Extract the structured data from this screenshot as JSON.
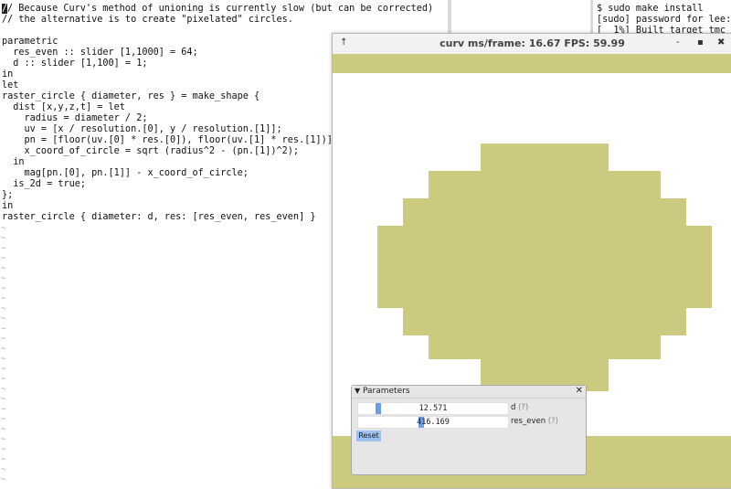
{
  "editor": {
    "lines": [
      "// Because Curv's method of unioning is currently slow (but can be corrected)",
      "// the alternative is to create \"pixelated\" circles.",
      "",
      "parametric",
      "  res_even :: slider [1,1000] = 64;",
      "  d :: slider [1,100] = 1;",
      "in",
      "let",
      "raster_circle { diameter, res } = make_shape {",
      "  dist [x,y,z,t] = let",
      "    radius = diameter / 2;",
      "    uv = [x / resolution.[0], y / resolution.[1]];",
      "    pn = [floor(uv.[0] * res.[0]), floor(uv.[1] * res.[1])]",
      "    x_coord_of_circle = sqrt (radius^2 - (pn.[1])^2);",
      "  in",
      "    mag[pn.[0], pn.[1]] - x_coord_of_circle;",
      "  is_2d = true;",
      "};",
      "in",
      "raster_circle { diameter: d, res: [res_even, res_even] }"
    ],
    "tilde": "~"
  },
  "terminal": {
    "lines": [
      "$ sudo make install",
      "[sudo] password for lee:",
      "[  1%] Built target tmc"
    ]
  },
  "curv_window": {
    "title": "curv ms/frame: 16.67 FPS: 59.99",
    "left_button": "↑",
    "btn_minimize": "-",
    "btn_maximize": "▪",
    "btn_close": "✖",
    "shape_color": "#cbca7e"
  },
  "parameters": {
    "title": "Parameters",
    "collapse_glyph": "▼",
    "close_glyph": "✕",
    "d": {
      "value": "12.571",
      "label": "d",
      "help": "(?)"
    },
    "res_even": {
      "value": "416.169",
      "label": "res_even",
      "help": "(?)"
    },
    "reset_label": "Reset"
  }
}
